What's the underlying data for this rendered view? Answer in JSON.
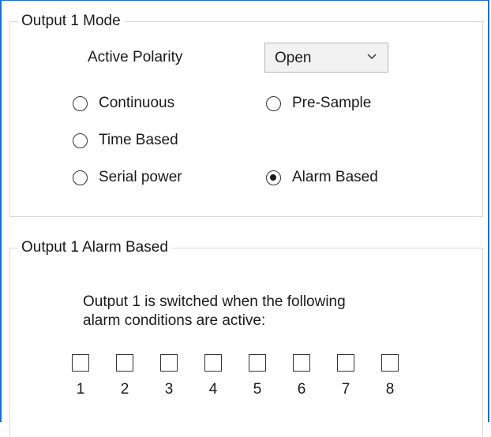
{
  "mode_group": {
    "title": "Output 1 Mode",
    "polarity_label": "Active Polarity",
    "polarity_value": "Open",
    "options": [
      {
        "label": "Continuous",
        "checked": false
      },
      {
        "label": "Pre-Sample",
        "checked": false
      },
      {
        "label": "Time Based",
        "checked": false
      },
      {
        "label": "Serial power",
        "checked": false
      },
      {
        "label": "Alarm Based",
        "checked": true
      }
    ]
  },
  "alarm_group": {
    "title": "Output 1 Alarm Based",
    "description_line1": "Output 1 is switched when the following",
    "description_line2": "alarm conditions are active:",
    "alarms": [
      {
        "label": "1",
        "checked": false
      },
      {
        "label": "2",
        "checked": false
      },
      {
        "label": "3",
        "checked": false
      },
      {
        "label": "4",
        "checked": false
      },
      {
        "label": "5",
        "checked": false
      },
      {
        "label": "6",
        "checked": false
      },
      {
        "label": "7",
        "checked": false
      },
      {
        "label": "8",
        "checked": false
      }
    ]
  }
}
